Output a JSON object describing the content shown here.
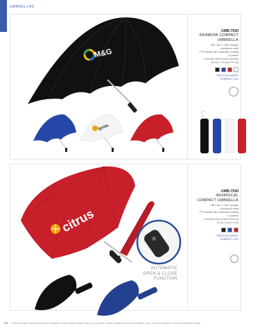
{
  "category": "UMBRELLAS",
  "products": [
    {
      "code": "UMB-7530",
      "name": "RAINBOW COMPACT UMBRELLA",
      "features": [
        "• 8B Cole | • 190T pongee",
        "• aluminium shaft",
        "• PP handle with rubberised coating",
        "• 8 panels",
        "• includes velour pouch (shown)",
        "28.5 (l) x 6.5 (w) x 5.5 (h)"
      ],
      "print_label": "PRICE INCLUDES*",
      "print_detail": "SCREEN 1 COL",
      "swatch_colors": [
        "#1a1a1a",
        "#2747a8",
        "#c8202b",
        "#ffffff"
      ],
      "brand_logo_text": "M&G"
    },
    {
      "code": "UMB-7530",
      "name_line1": "WHIMSICAL",
      "name_line2": "COMPACT UMBRELLA",
      "features": [
        "• 8B Cole | • 190T pongee",
        "• aluminium shaft",
        "• PP handle with rubberised coating",
        "• 8 panels",
        "• includes velour pouch (shown)",
        "31 (l) x 6 (w) x 5 (h)"
      ],
      "print_label": "PRICE INCLUDES*",
      "print_detail": "SCREEN 1 COL",
      "swatch_colors": [
        "#1a1a1a",
        "#2747a8",
        "#c8202b"
      ],
      "brand_logo_text": "citrus",
      "caption_line1": "AUTOMATIC",
      "caption_line2": "OPEN & CLOSE",
      "caption_line3": "FUNCTION"
    }
  ],
  "small_logo_text": "ignite",
  "footer": {
    "page_number": "326",
    "disclaimer": "Where multiple branding options are available, prices include printing only on one position. Where multiple colours are available, each colour and position carries an additional charge."
  },
  "colors": {
    "accent": "#3b5ba9",
    "black": "#111111",
    "blue": "#2747a8",
    "white": "#f4f4f4",
    "red": "#c8202b"
  }
}
